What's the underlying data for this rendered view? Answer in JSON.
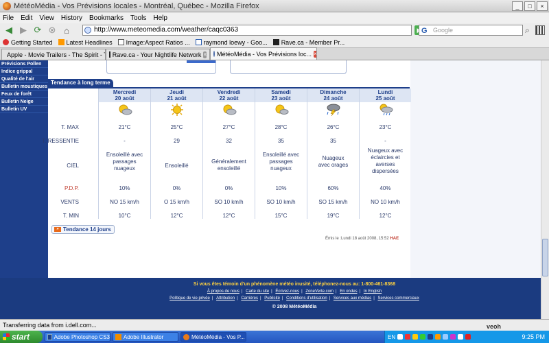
{
  "window": {
    "title": "MétéoMédia - Vos Prévisions locales - Montréal, Québec - Mozilla Firefox"
  },
  "menu": [
    "File",
    "Edit",
    "View",
    "History",
    "Bookmarks",
    "Tools",
    "Help"
  ],
  "nav": {
    "url": "http://www.meteomedia.com/weather/caqc0363",
    "search_placeholder": "Google"
  },
  "bookmarks": [
    "Getting Started",
    "Latest Headlines",
    "Image:Aspect Ratios ...",
    "raymond loewy - Goo...",
    "Rave.ca - Member Pr..."
  ],
  "tabs": [
    {
      "label": "Apple - Movie Trailers - The Spirit - Tra...",
      "active": false
    },
    {
      "label": "Rave.ca - Your Nightlife Network",
      "active": false
    },
    {
      "label": "MétéoMédia - Vos Prévisions loc...",
      "active": true
    }
  ],
  "leftnav": [
    "Prévisions Pollen",
    "Indice grippal",
    "Qualité de l'air",
    "Bulletin moustiques",
    "Feux de forêt",
    "Bulletin Neige",
    "Bulletin UV"
  ],
  "section_tab": "Tendance à long terme",
  "row_labels": {
    "tmax": "T. MAX",
    "tressentie": "T. RESSENTIE",
    "ciel": "CIEL",
    "pdp": "P.D.P.",
    "vents": "VENTS",
    "tmin": "T. MIN"
  },
  "days": [
    {
      "name": "Mercredi",
      "date": "20 août",
      "icon": "sun-cloud-icon",
      "tmax": "21°C",
      "tres": "-",
      "ciel": "Ensoleillé avec passages nuageux",
      "pdp": "10%",
      "vents": "NO 15 km/h",
      "tmin": "10°C"
    },
    {
      "name": "Jeudi",
      "date": "21 août",
      "icon": "sun-icon",
      "tmax": "25°C",
      "tres": "29",
      "ciel": "Ensoleillé",
      "pdp": "0%",
      "vents": "O 15 km/h",
      "tmin": "12°C"
    },
    {
      "name": "Vendredi",
      "date": "22 août",
      "icon": "sun-cloud-icon",
      "tmax": "27°C",
      "tres": "32",
      "ciel": "Généralement ensoleillé",
      "pdp": "0%",
      "vents": "SO 10 km/h",
      "tmin": "12°C"
    },
    {
      "name": "Samedi",
      "date": "23 août",
      "icon": "sun-cloud-icon",
      "tmax": "28°C",
      "tres": "35",
      "ciel": "Ensoleillé avec passages nuageux",
      "pdp": "10%",
      "vents": "SO 10 km/h",
      "tmin": "15°C"
    },
    {
      "name": "Dimanche",
      "date": "24 août",
      "icon": "thunderstorm-icon",
      "tmax": "26°C",
      "tres": "35",
      "ciel": "Nuageux avec orages",
      "pdp": "60%",
      "vents": "SO 15 km/h",
      "tmin": "19°C"
    },
    {
      "name": "Lundi",
      "date": "25 août",
      "icon": "sun-cloud-rain-icon",
      "tmax": "23°C",
      "tres": "-",
      "ciel": "Nuageux avec éclaircies et averses dispersées",
      "pdp": "40%",
      "vents": "NO 10 km/h",
      "tmin": "12°C"
    }
  ],
  "tendance14": "Tendance 14 jours",
  "emis": "Émis le :Lundi 18 août 2008, 15:52",
  "emis_tz": "HAE",
  "footer": {
    "alert": "Si vous êtes témoin d'un phénomène météo inusité, téléphonez-nous au: 1-800-461-8368",
    "links1": [
      "À propos de nous",
      "Carte du site",
      "Écrivez-nous",
      "ZoneVerte.com",
      "En ondes",
      "In English"
    ],
    "links2": [
      "Politique de vie privée",
      "Attribution",
      "Carrières",
      "Publicité",
      "Conditions d'utilisation",
      "Services aux médias",
      "Services commerciaux"
    ],
    "copy": "© 2008 MétéoMédia"
  },
  "status": "Transferring data from i.dell.com...",
  "status_right": "veoh",
  "taskbar": {
    "start": "start",
    "items": [
      "Adobe Photoshop CS3",
      "Adobe Illustrator",
      "MétéoMédia - Vos P..."
    ],
    "lang": "EN",
    "clock": "9:25 PM"
  }
}
